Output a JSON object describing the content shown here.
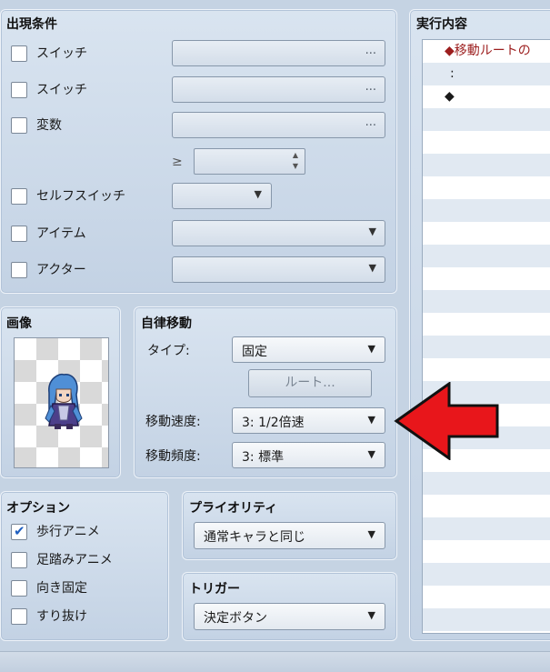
{
  "conditions": {
    "title": "出現条件",
    "switch1_label": "スイッチ",
    "switch2_label": "スイッチ",
    "variable_label": "変数",
    "dots": "...",
    "gte_symbol": "≥",
    "self_switch_label": "セルフスイッチ",
    "item_label": "アイテム",
    "actor_label": "アクター"
  },
  "contents": {
    "title": "実行内容",
    "rows": [
      "◆移動ルートの",
      ":",
      "◆"
    ]
  },
  "image": {
    "title": "画像"
  },
  "autonomous": {
    "title": "自律移動",
    "type_label": "タイプ:",
    "type_value": "固定",
    "route_button": "ルート...",
    "speed_label": "移動速度:",
    "speed_value": "3: 1/2倍速",
    "freq_label": "移動頻度:",
    "freq_value": "3: 標準"
  },
  "options": {
    "title": "オプション",
    "walking_label": "歩行アニメ",
    "walking_checked": true,
    "stepping_label": "足踏みアニメ",
    "direction_fix_label": "向き固定",
    "through_label": "すり抜け"
  },
  "priority": {
    "title": "プライオリティ",
    "value": "通常キャラと同じ"
  },
  "trigger": {
    "title": "トリガー",
    "value": "決定ボタン"
  },
  "annotation": {
    "arrow_color": "#e8161b"
  }
}
